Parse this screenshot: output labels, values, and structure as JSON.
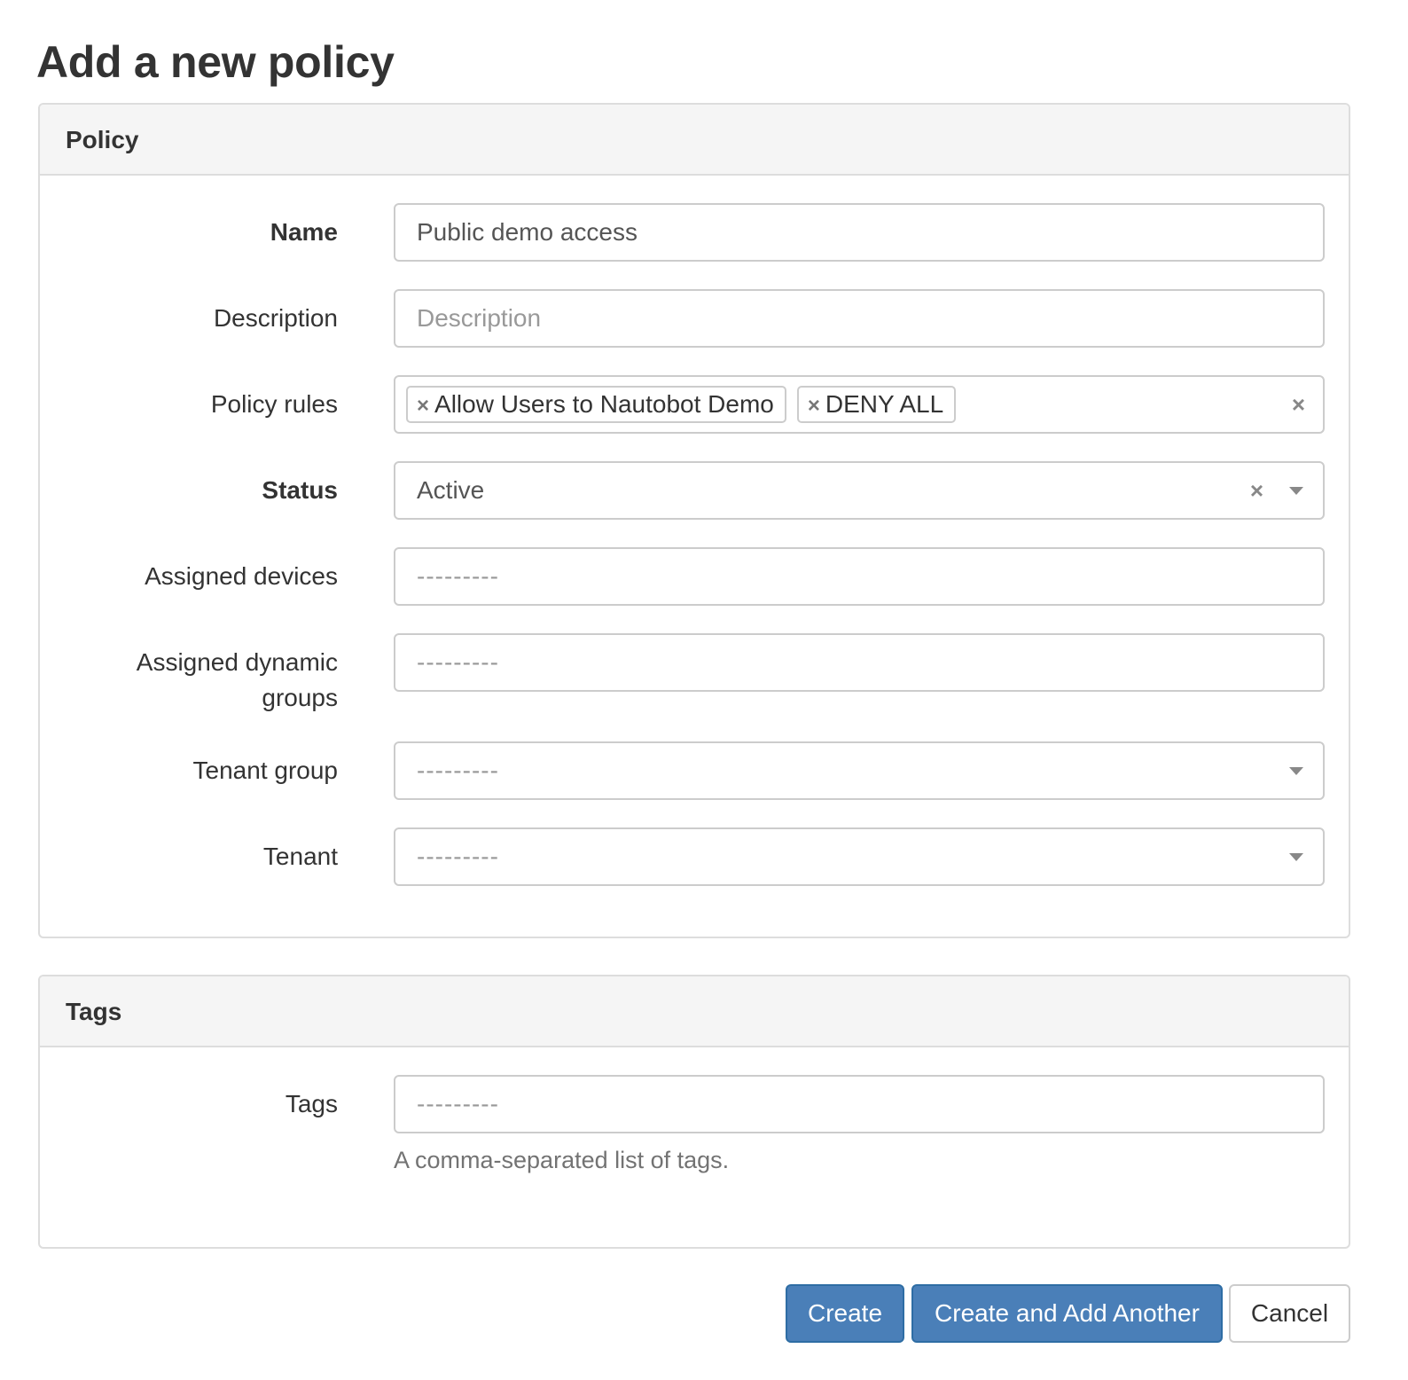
{
  "page": {
    "title": "Add a new policy"
  },
  "policy_panel": {
    "heading": "Policy",
    "fields": {
      "name": {
        "label": "Name",
        "value": "Public demo access"
      },
      "description": {
        "label": "Description",
        "value": "",
        "placeholder": "Description"
      },
      "policy_rules": {
        "label": "Policy rules",
        "selected": [
          "Allow Users to Nautobot Demo",
          "DENY ALL"
        ]
      },
      "status": {
        "label": "Status",
        "value": "Active"
      },
      "assigned_devices": {
        "label": "Assigned devices",
        "value": "---------"
      },
      "assigned_dynamic_groups": {
        "label_line1": "Assigned dynamic",
        "label_line2": "groups",
        "value": "---------"
      },
      "tenant_group": {
        "label": "Tenant group",
        "value": "---------"
      },
      "tenant": {
        "label": "Tenant",
        "value": "---------"
      }
    }
  },
  "tags_panel": {
    "heading": "Tags",
    "fields": {
      "tags": {
        "label": "Tags",
        "value": "---------",
        "help_text": "A comma-separated list of tags."
      }
    }
  },
  "actions": {
    "create_label": "Create",
    "create_and_add_label": "Create and Add Another",
    "cancel_label": "Cancel"
  },
  "icons": {
    "remove_glyph": "×",
    "clear_icon": "close-icon",
    "dropdown_icon": "caret-down-icon"
  },
  "colors": {
    "primary_button": "#4a7fb8",
    "panel_heading_bg": "#f5f5f5",
    "border": "#cccccc"
  }
}
